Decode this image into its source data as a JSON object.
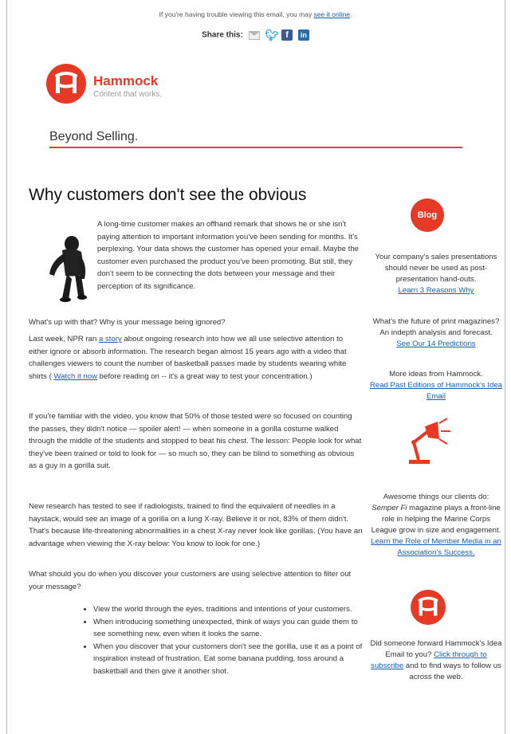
{
  "header": {
    "trouble_text": "If you're having trouble viewing this email, you may ",
    "trouble_link": "see it online",
    "trouble_end": ".",
    "share_label": "Share this:"
  },
  "icons": {
    "share": [
      "email-icon",
      "twitter-icon",
      "facebook-icon",
      "linkedin-icon"
    ],
    "logo": "hammock-logo-icon",
    "blog": "blog-badge-icon",
    "lamp": "lamp-icon"
  },
  "brand": {
    "name": "Hammock",
    "tagline": "Content that works.",
    "accent_color": "#e63a26",
    "link_color": "#1a5fb4"
  },
  "section_title": "Beyond Selling.",
  "article": {
    "headline": "Why customers don't see the obvious",
    "intro": "A long-time customer makes an offhand remark that shows he or she isn't paying attention to important information you've been sending for months. It's perplexing. Your data shows the customer has opened your email. Maybe the customer even purchased the product you've been promoting. But still, they don't seem to be connecting the dots between your message and their perception of its significance.",
    "p1": "What's up with that? Why is your message being ignored?",
    "p2_a": "Last week, NPR ran ",
    "p2_link": "a story",
    "p2_b": " about ongoing research into how we all use selective attention to either ignore or absorb information. The research began almost 15 years ago with a video that challenges viewers to count the number of basketball passes made by students wearing white shirts  ( ",
    "p2_link2": "Watch it now",
    "p2_c": " before reading on -- it's a great way to test your concentration.)",
    "p3": "If you're familiar with the video, you know that 50% of those tested were so focused on counting the passes, they didn't notice — spoiler alert! — when someone in a gorilla costume walked through the middle of the students and stopped to beat his chest. The lesson: People look for what they've been trained or told to look for — so much so, they can be blind to something as obvious as a guy in a gorilla suit.",
    "p4": "New research has tested to see if radiologists, trained to find the equivalent of needles in a haystack, would see an image of a gorilla on a lung X-ray. Believe it or not, 83% of them didn't. That's because life-threatening abnormalities in a chest X-ray never look like gorillas. (You have an advantage when viewing the X-ray below: You know to look for one.)",
    "p5": "What should you do when you discover your customers are using selective attention to filter out your message?",
    "bullets": [
      "View the world through the eyes, traditions and intentions of your customers.",
      "When introducing something unexpected, think of ways you can guide them to see something new, even when it looks the same.",
      "When you discover that your customers don't see the gorilla, use it as a point of inspiration instead of frustration. Eat some banana pudding, toss around a basketball and then give it another shot."
    ]
  },
  "sidebar": {
    "blog_label": "Blog",
    "block1_text": "Your company's sales presentations should never be used as post-presentation hand-outs.",
    "block1_link": "Learn 3 Reasons Why",
    "block2_text": "What's the future of print magazines? An indepth analysis and forecast.",
    "block2_link": "See Our 14 Predictions",
    "block3_text": "More ideas from Hammock.",
    "block3_link": "Read Past Editions of Hammock's Idea Email",
    "block4_text_a": "Awesome things our clients do: ",
    "block4_em": "Semper Fi",
    "block4_text_b": " magazine plays a front-line role in helping the Marine Corps League grow in size and engagement.",
    "block4_link": "Learn the Role of Member Media in an Association's Success.",
    "block5_text_a": "Did someone forward Hammock's Idea Email to you? ",
    "block5_link": "Click through to subscribe",
    "block5_text_b": " and to find ways to follow us across the web."
  }
}
